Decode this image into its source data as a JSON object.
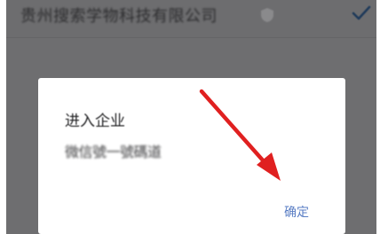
{
  "list_row": {
    "company_name": "贵州搜索学物科技有限公司",
    "shield_icon": "shield-icon",
    "check_icon": "check-icon",
    "check_color": "#1f3a5a"
  },
  "dialog": {
    "title": "进入企业",
    "message": "微信號一號碼道",
    "confirm_label": "确定",
    "confirm_color": "#5a7ec4"
  },
  "annotation": {
    "arrow_icon": "red-arrow-icon",
    "arrow_color": "#e02020"
  },
  "colors": {
    "overlay": "#6e6e70",
    "dialog_background": "#ffffff"
  }
}
